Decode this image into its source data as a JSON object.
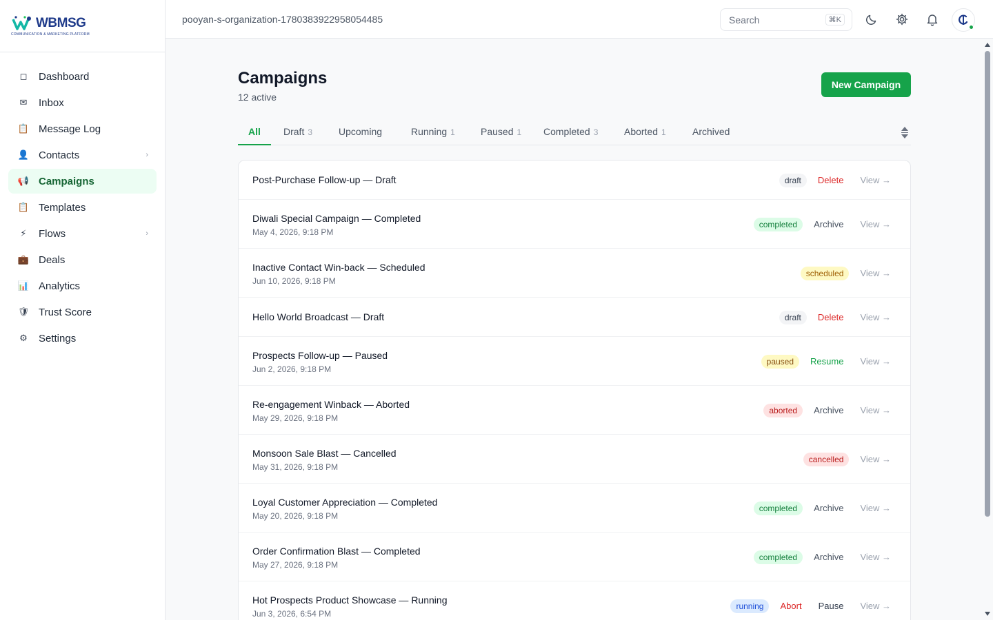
{
  "brand": {
    "name": "WBMSG",
    "tagline": "COMMUNICATION & MARKETING PLATFORM"
  },
  "sidebar": {
    "items": [
      {
        "label": "Dashboard",
        "icon": "square-icon",
        "glyph": "◻",
        "active": false,
        "chevron": false
      },
      {
        "label": "Inbox",
        "icon": "mail-icon",
        "glyph": "✉",
        "active": false,
        "chevron": false
      },
      {
        "label": "Message Log",
        "icon": "clipboard-icon",
        "glyph": "📋",
        "active": false,
        "chevron": false
      },
      {
        "label": "Contacts",
        "icon": "person-icon",
        "glyph": "👤",
        "active": false,
        "chevron": true
      },
      {
        "label": "Campaigns",
        "icon": "megaphone-icon",
        "glyph": "📢",
        "active": true,
        "chevron": false
      },
      {
        "label": "Templates",
        "icon": "clipboard-icon",
        "glyph": "📋",
        "active": false,
        "chevron": false
      },
      {
        "label": "Flows",
        "icon": "lightning-icon",
        "glyph": "⚡",
        "active": false,
        "chevron": true
      },
      {
        "label": "Deals",
        "icon": "briefcase-icon",
        "glyph": "💼",
        "active": false,
        "chevron": false
      },
      {
        "label": "Analytics",
        "icon": "bar-chart-icon",
        "glyph": "📊",
        "active": false,
        "chevron": false
      },
      {
        "label": "Trust Score",
        "icon": "shield-icon",
        "glyph": "🛡",
        "active": false,
        "chevron": false
      },
      {
        "label": "Settings",
        "icon": "gear-icon",
        "glyph": "⚙",
        "active": false,
        "chevron": false
      }
    ],
    "chevron_glyph": "›"
  },
  "header": {
    "org_name": "pooyan-s-organization-1780383922958054485",
    "search_placeholder": "Search",
    "search_shortcut": "⌘K"
  },
  "page": {
    "title": "Campaigns",
    "subtitle": "12 active",
    "new_button": "New Campaign"
  },
  "tabs": [
    {
      "label": "All",
      "count": "",
      "active": true
    },
    {
      "label": "Draft",
      "count": "3",
      "active": false
    },
    {
      "label": "Upcoming",
      "count": "",
      "active": false
    },
    {
      "label": "Running",
      "count": "1",
      "active": false
    },
    {
      "label": "Paused",
      "count": "1",
      "active": false
    },
    {
      "label": "Completed",
      "count": "3",
      "active": false
    },
    {
      "label": "Aborted",
      "count": "1",
      "active": false
    },
    {
      "label": "Archived",
      "count": "",
      "active": false
    }
  ],
  "colors": {
    "accent": "#16a34a",
    "draft_bg": "#f3f4f6",
    "draft_fg": "#374151",
    "completed_bg": "#dcfce7",
    "completed_fg": "#15803d",
    "scheduled_bg": "#fef9c3",
    "scheduled_fg": "#a16207",
    "paused_bg": "#fef9c3",
    "paused_fg": "#854d0e",
    "aborted_bg": "#fee2e2",
    "aborted_fg": "#b91c1c",
    "cancelled_bg": "#fee2e2",
    "cancelled_fg": "#b91c1c",
    "running_bg": "#dbeafe",
    "running_fg": "#1d4ed8",
    "delete_fg": "#dc2626",
    "archive_fg": "#4b5563",
    "resume_fg": "#16a34a",
    "abort_fg": "#dc2626",
    "pause_fg": "#374151"
  },
  "campaigns": [
    {
      "title": "Post-Purchase Follow-up — Draft",
      "date": "",
      "status": "draft",
      "actions": [
        "Delete"
      ],
      "view": "View →"
    },
    {
      "title": "Diwali Special Campaign — Completed",
      "date": "May 4, 2026, 9:18 PM",
      "status": "completed",
      "actions": [
        "Archive"
      ],
      "view": "View →"
    },
    {
      "title": "Inactive Contact Win-back — Scheduled",
      "date": "Jun 10, 2026, 9:18 PM",
      "status": "scheduled",
      "actions": [],
      "view": "View →"
    },
    {
      "title": "Hello World Broadcast — Draft",
      "date": "",
      "status": "draft",
      "actions": [
        "Delete"
      ],
      "view": "View →"
    },
    {
      "title": "Prospects Follow-up — Paused",
      "date": "Jun 2, 2026, 9:18 PM",
      "status": "paused",
      "actions": [
        "Resume"
      ],
      "view": "View →"
    },
    {
      "title": "Re-engagement Winback — Aborted",
      "date": "May 29, 2026, 9:18 PM",
      "status": "aborted",
      "actions": [
        "Archive"
      ],
      "view": "View →"
    },
    {
      "title": "Monsoon Sale Blast — Cancelled",
      "date": "May 31, 2026, 9:18 PM",
      "status": "cancelled",
      "actions": [],
      "view": "View →"
    },
    {
      "title": "Loyal Customer Appreciation — Completed",
      "date": "May 20, 2026, 9:18 PM",
      "status": "completed",
      "actions": [
        "Archive"
      ],
      "view": "View →"
    },
    {
      "title": "Order Confirmation Blast — Completed",
      "date": "May 27, 2026, 9:18 PM",
      "status": "completed",
      "actions": [
        "Archive"
      ],
      "view": "View →"
    },
    {
      "title": "Hot Prospects Product Showcase — Running",
      "date": "Jun 3, 2026, 6:54 PM",
      "status": "running",
      "actions": [
        "Abort",
        "Pause"
      ],
      "view": "View →"
    }
  ]
}
